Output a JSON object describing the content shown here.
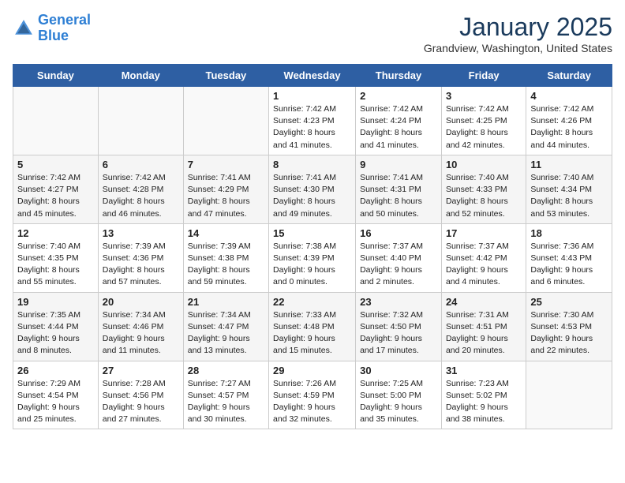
{
  "header": {
    "logo_line1": "General",
    "logo_line2": "Blue",
    "month": "January 2025",
    "location": "Grandview, Washington, United States"
  },
  "weekdays": [
    "Sunday",
    "Monday",
    "Tuesday",
    "Wednesday",
    "Thursday",
    "Friday",
    "Saturday"
  ],
  "weeks": [
    [
      {
        "day": "",
        "info": ""
      },
      {
        "day": "",
        "info": ""
      },
      {
        "day": "",
        "info": ""
      },
      {
        "day": "1",
        "info": "Sunrise: 7:42 AM\nSunset: 4:23 PM\nDaylight: 8 hours and 41 minutes."
      },
      {
        "day": "2",
        "info": "Sunrise: 7:42 AM\nSunset: 4:24 PM\nDaylight: 8 hours and 41 minutes."
      },
      {
        "day": "3",
        "info": "Sunrise: 7:42 AM\nSunset: 4:25 PM\nDaylight: 8 hours and 42 minutes."
      },
      {
        "day": "4",
        "info": "Sunrise: 7:42 AM\nSunset: 4:26 PM\nDaylight: 8 hours and 44 minutes."
      }
    ],
    [
      {
        "day": "5",
        "info": "Sunrise: 7:42 AM\nSunset: 4:27 PM\nDaylight: 8 hours and 45 minutes."
      },
      {
        "day": "6",
        "info": "Sunrise: 7:42 AM\nSunset: 4:28 PM\nDaylight: 8 hours and 46 minutes."
      },
      {
        "day": "7",
        "info": "Sunrise: 7:41 AM\nSunset: 4:29 PM\nDaylight: 8 hours and 47 minutes."
      },
      {
        "day": "8",
        "info": "Sunrise: 7:41 AM\nSunset: 4:30 PM\nDaylight: 8 hours and 49 minutes."
      },
      {
        "day": "9",
        "info": "Sunrise: 7:41 AM\nSunset: 4:31 PM\nDaylight: 8 hours and 50 minutes."
      },
      {
        "day": "10",
        "info": "Sunrise: 7:40 AM\nSunset: 4:33 PM\nDaylight: 8 hours and 52 minutes."
      },
      {
        "day": "11",
        "info": "Sunrise: 7:40 AM\nSunset: 4:34 PM\nDaylight: 8 hours and 53 minutes."
      }
    ],
    [
      {
        "day": "12",
        "info": "Sunrise: 7:40 AM\nSunset: 4:35 PM\nDaylight: 8 hours and 55 minutes."
      },
      {
        "day": "13",
        "info": "Sunrise: 7:39 AM\nSunset: 4:36 PM\nDaylight: 8 hours and 57 minutes."
      },
      {
        "day": "14",
        "info": "Sunrise: 7:39 AM\nSunset: 4:38 PM\nDaylight: 8 hours and 59 minutes."
      },
      {
        "day": "15",
        "info": "Sunrise: 7:38 AM\nSunset: 4:39 PM\nDaylight: 9 hours and 0 minutes."
      },
      {
        "day": "16",
        "info": "Sunrise: 7:37 AM\nSunset: 4:40 PM\nDaylight: 9 hours and 2 minutes."
      },
      {
        "day": "17",
        "info": "Sunrise: 7:37 AM\nSunset: 4:42 PM\nDaylight: 9 hours and 4 minutes."
      },
      {
        "day": "18",
        "info": "Sunrise: 7:36 AM\nSunset: 4:43 PM\nDaylight: 9 hours and 6 minutes."
      }
    ],
    [
      {
        "day": "19",
        "info": "Sunrise: 7:35 AM\nSunset: 4:44 PM\nDaylight: 9 hours and 8 minutes."
      },
      {
        "day": "20",
        "info": "Sunrise: 7:34 AM\nSunset: 4:46 PM\nDaylight: 9 hours and 11 minutes."
      },
      {
        "day": "21",
        "info": "Sunrise: 7:34 AM\nSunset: 4:47 PM\nDaylight: 9 hours and 13 minutes."
      },
      {
        "day": "22",
        "info": "Sunrise: 7:33 AM\nSunset: 4:48 PM\nDaylight: 9 hours and 15 minutes."
      },
      {
        "day": "23",
        "info": "Sunrise: 7:32 AM\nSunset: 4:50 PM\nDaylight: 9 hours and 17 minutes."
      },
      {
        "day": "24",
        "info": "Sunrise: 7:31 AM\nSunset: 4:51 PM\nDaylight: 9 hours and 20 minutes."
      },
      {
        "day": "25",
        "info": "Sunrise: 7:30 AM\nSunset: 4:53 PM\nDaylight: 9 hours and 22 minutes."
      }
    ],
    [
      {
        "day": "26",
        "info": "Sunrise: 7:29 AM\nSunset: 4:54 PM\nDaylight: 9 hours and 25 minutes."
      },
      {
        "day": "27",
        "info": "Sunrise: 7:28 AM\nSunset: 4:56 PM\nDaylight: 9 hours and 27 minutes."
      },
      {
        "day": "28",
        "info": "Sunrise: 7:27 AM\nSunset: 4:57 PM\nDaylight: 9 hours and 30 minutes."
      },
      {
        "day": "29",
        "info": "Sunrise: 7:26 AM\nSunset: 4:59 PM\nDaylight: 9 hours and 32 minutes."
      },
      {
        "day": "30",
        "info": "Sunrise: 7:25 AM\nSunset: 5:00 PM\nDaylight: 9 hours and 35 minutes."
      },
      {
        "day": "31",
        "info": "Sunrise: 7:23 AM\nSunset: 5:02 PM\nDaylight: 9 hours and 38 minutes."
      },
      {
        "day": "",
        "info": ""
      }
    ]
  ]
}
